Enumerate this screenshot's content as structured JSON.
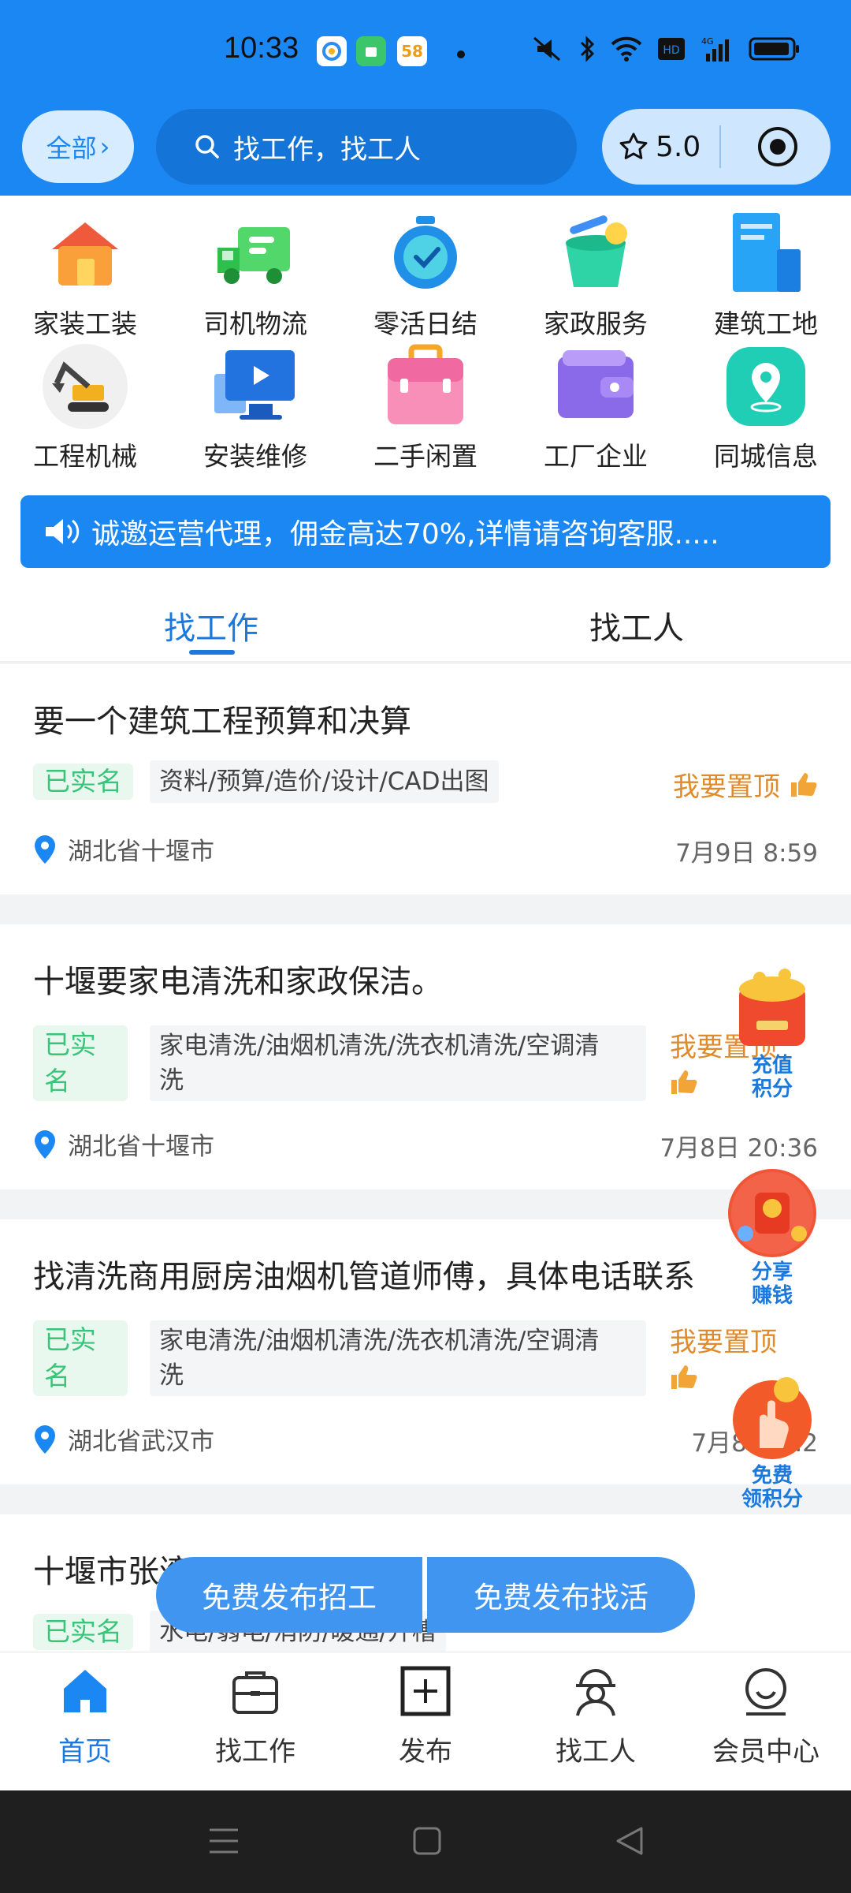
{
  "status": {
    "time": "10:33",
    "app_badge_58": "58"
  },
  "header": {
    "all_label": "全部",
    "search_placeholder": "找工作，找工人",
    "rating": "5.0"
  },
  "categories": [
    {
      "label": "家装工装",
      "icon": "house-icon"
    },
    {
      "label": "司机物流",
      "icon": "truck-icon"
    },
    {
      "label": "零活日结",
      "icon": "stopwatch-icon"
    },
    {
      "label": "家政服务",
      "icon": "cleaning-bucket-icon"
    },
    {
      "label": "建筑工地",
      "icon": "building-icon"
    },
    {
      "label": "工程机械",
      "icon": "excavator-icon"
    },
    {
      "label": "安装维修",
      "icon": "monitor-icon"
    },
    {
      "label": "二手闲置",
      "icon": "briefcase-icon"
    },
    {
      "label": "工厂企业",
      "icon": "wallet-icon"
    },
    {
      "label": "同城信息",
      "icon": "location-icon"
    }
  ],
  "notice": "诚邀运营代理，佣金高达70%,详情请咨询客服.....",
  "tabs": {
    "find_job": "找工作",
    "find_worker": "找工人"
  },
  "jobs": [
    {
      "title": "要一个建筑工程预算和决算",
      "badge": "已实名",
      "tags": "资料/预算/造价/设计/CAD出图",
      "pin": "我要置顶",
      "location": "湖北省十堰市",
      "date": "7月9日 8:59"
    },
    {
      "title": "十堰要家电清洗和家政保洁。",
      "badge_l1": "已实",
      "badge_l2": "名",
      "tags_l1": "家电清洗/油烟机清洗/洗衣机清洗/空调清",
      "tags_l2": "洗",
      "pin": "我要置顶",
      "location": "湖北省十堰市",
      "date": "7月8日 20:36"
    },
    {
      "title": "找清洗商用厨房油烟机管道师傅，具体电话联系",
      "badge_l1": "已实",
      "badge_l2": "名",
      "tags_l1": "家电清洗/油烟机清洗/洗衣机清洗/空调清",
      "tags_l2": "洗",
      "pin": "我要置顶",
      "location": "湖北省武汉市",
      "date": "7月8日 ...2"
    },
    {
      "title": "十堰市张湾区...",
      "badge": "已实名",
      "tags": "水电/弱电/消防/暖通/开槽"
    }
  ],
  "floats": [
    {
      "l1": "充值",
      "l2": "积分"
    },
    {
      "l1": "分享",
      "l2": "赚钱"
    },
    {
      "l1": "免费",
      "l2": "领积分"
    }
  ],
  "publish": {
    "recruit": "免费发布招工",
    "find_work": "免费发布找活"
  },
  "nav": [
    {
      "label": "首页",
      "icon": "home-icon"
    },
    {
      "label": "找工作",
      "icon": "briefcase-icon"
    },
    {
      "label": "发布",
      "icon": "plus-box-icon"
    },
    {
      "label": "找工人",
      "icon": "worker-icon"
    },
    {
      "label": "会员中心",
      "icon": "member-icon"
    }
  ],
  "colors": {
    "primary": "#1b87f2",
    "accent_text": "#1b78dc",
    "pin_orange": "#e08a2b",
    "verified_green": "#3ac47a"
  }
}
